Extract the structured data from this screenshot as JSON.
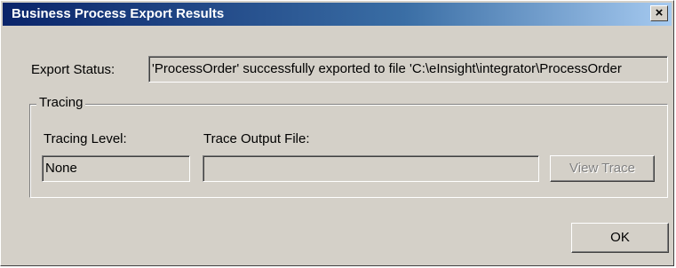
{
  "window": {
    "title": "Business Process Export Results",
    "close_glyph": "✕"
  },
  "export": {
    "status_label": "Export Status:",
    "status_value": "'ProcessOrder' successfully exported to file 'C:\\eInsight\\integrator\\ProcessOrder"
  },
  "tracing": {
    "group_label": "Tracing",
    "level_label": "Tracing Level:",
    "level_value": "None",
    "output_label": "Trace Output File:",
    "output_value": "",
    "view_trace_label": "View Trace"
  },
  "actions": {
    "ok_label": "OK"
  },
  "colors": {
    "title_start": "#0a246a",
    "title_end": "#a6caf0",
    "face": "#d4d0c8"
  }
}
